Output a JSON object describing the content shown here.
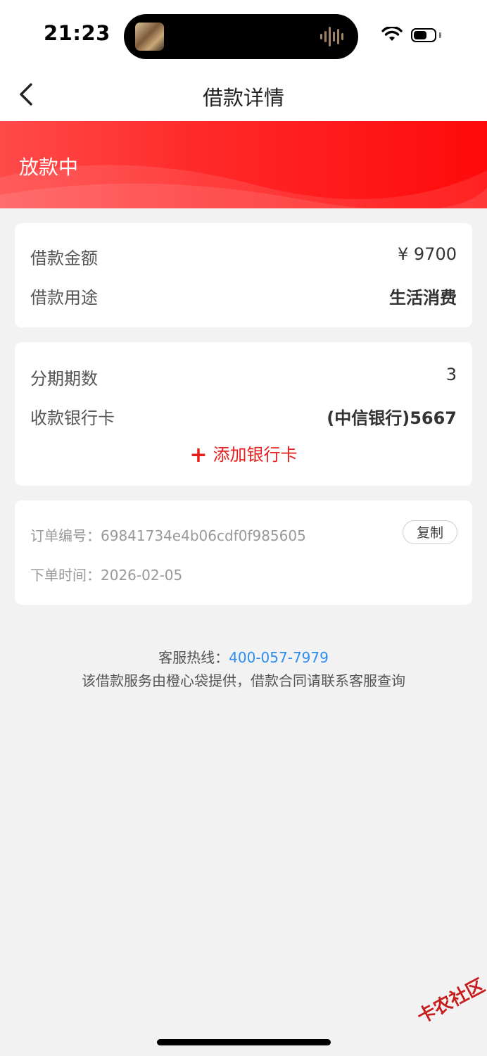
{
  "status_bar": {
    "time": "21:23",
    "battery_level": 0.65
  },
  "nav": {
    "title": "借款详情",
    "back_icon": "chevron-left-icon"
  },
  "banner": {
    "status": "放款中"
  },
  "loan_card": {
    "amount_label": "借款金额",
    "amount_value": "¥ 9700",
    "purpose_label": "借款用途",
    "purpose_value": "生活消费"
  },
  "repay_card": {
    "periods_label": "分期期数",
    "periods_value": "3",
    "bank_label": "收款银行卡",
    "bank_value": "(中信银行)5667",
    "add_bank_label": "添加银行卡"
  },
  "order_card": {
    "order_no_label": "订单编号：",
    "order_no": "69841734e4b06cdf0f985605",
    "copy_label": "复制",
    "time_label": "下单时间：",
    "time_value": "2026-02-05"
  },
  "footer": {
    "hotline_label": "客服热线：",
    "hotline_number": "400-057-7979",
    "note": "该借款服务由橙心袋提供，借款合同请联系客服查询"
  },
  "watermark": {
    "text": "卡农社区"
  },
  "colors": {
    "accent_red": "#ff1a1a",
    "link_blue": "#2b8ef0",
    "add_red": "#e81e1e"
  }
}
